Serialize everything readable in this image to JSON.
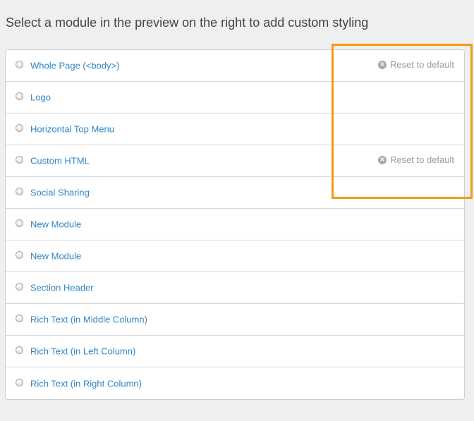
{
  "heading": "Select a module in the preview on the right to add custom styling",
  "modules": [
    {
      "label": "Whole Page (<body>)",
      "reset_label": "Reset to default"
    },
    {
      "label": "Logo",
      "reset_label": ""
    },
    {
      "label": "Horizontal Top Menu",
      "reset_label": ""
    },
    {
      "label": "Custom HTML",
      "reset_label": "Reset to default"
    },
    {
      "label": "Social Sharing",
      "reset_label": ""
    },
    {
      "label": "New Module",
      "reset_label": ""
    },
    {
      "label": "New Module",
      "reset_label": ""
    },
    {
      "label": "Section Header",
      "reset_label": ""
    },
    {
      "label": "Rich Text (in Middle Column)",
      "reset_label": ""
    },
    {
      "label": "Rich Text (in Left Column)",
      "reset_label": ""
    },
    {
      "label": "Rich Text (in Right Column)",
      "reset_label": ""
    }
  ],
  "icons": {
    "radio": "radio-button-icon",
    "reset": "reset-circle-x-icon"
  },
  "colors": {
    "link": "#2f86c8",
    "reset_text": "#9c9c9c",
    "highlight": "#f39c12",
    "background": "#efefef"
  }
}
